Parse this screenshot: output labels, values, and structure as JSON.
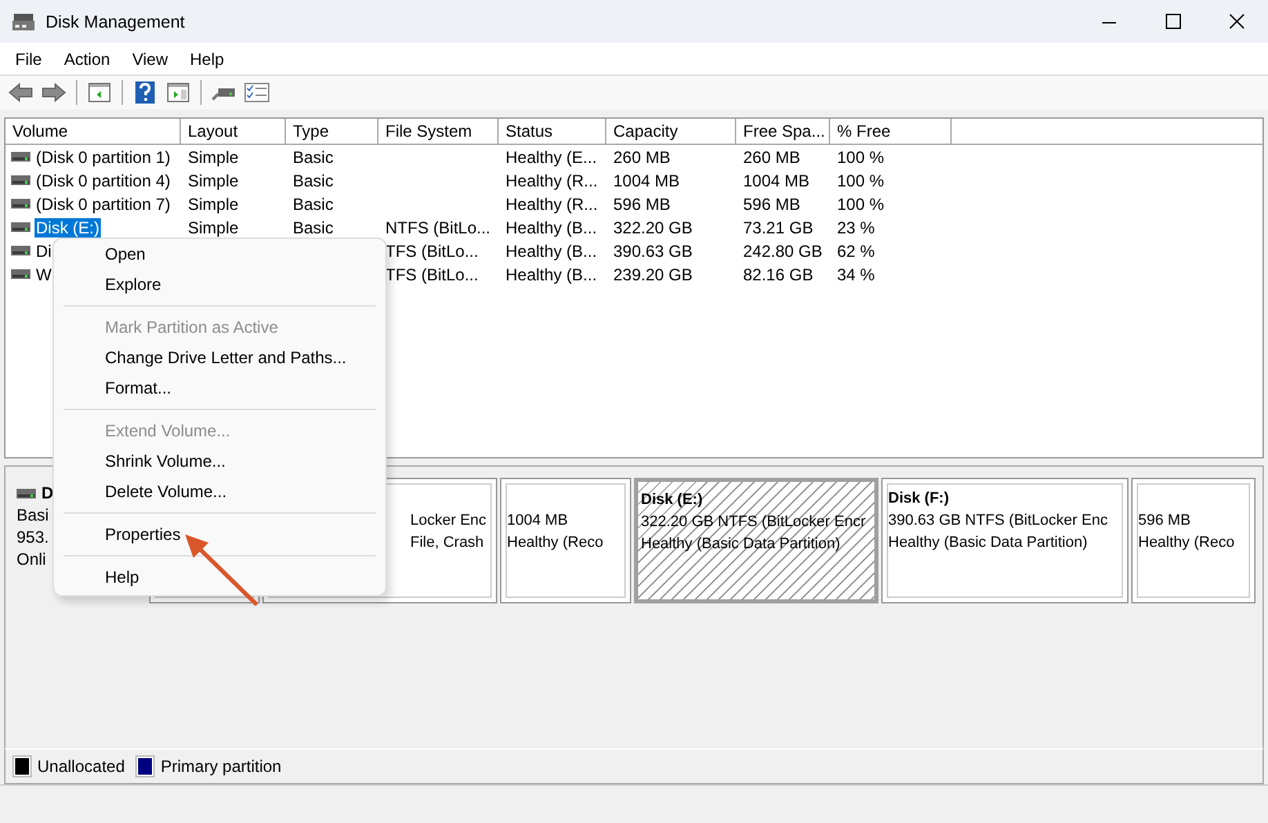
{
  "window": {
    "title": "Disk Management"
  },
  "menu_bar": [
    "File",
    "Action",
    "View",
    "Help"
  ],
  "volume_table": {
    "columns": [
      "Volume",
      "Layout",
      "Type",
      "File System",
      "Status",
      "Capacity",
      "Free Spa...",
      "% Free"
    ],
    "rows": [
      {
        "volume": "(Disk 0 partition 1)",
        "layout": "Simple",
        "type": "Basic",
        "status": "Healthy (E...",
        "capacity": "260 MB",
        "free_space": "260 MB",
        "percent_free": "100 %",
        "selected": false
      },
      {
        "volume": "(Disk 0 partition 4)",
        "layout": "Simple",
        "type": "Basic",
        "status": "Healthy (R...",
        "capacity": "1004 MB",
        "free_space": "1004 MB",
        "percent_free": "100 %",
        "selected": false
      },
      {
        "volume": "(Disk 0 partition 7)",
        "layout": "Simple",
        "type": "Basic",
        "status": "Healthy (R...",
        "capacity": "596 MB",
        "free_space": "596 MB",
        "percent_free": "100 %",
        "selected": false
      },
      {
        "volume": "Disk (E:)",
        "layout": "Simple",
        "type": "Basic",
        "file_system": "NTFS (BitLo...",
        "status": "Healthy (B...",
        "capacity": "322.20 GB",
        "free_space": "73.21 GB",
        "percent_free": "23 %",
        "selected": true
      },
      {
        "volume": "Di",
        "file_system": "TFS (BitLo...",
        "status": "Healthy (B...",
        "capacity": "390.63 GB",
        "free_space": "242.80 GB",
        "percent_free": "62 %",
        "selected": false
      },
      {
        "volume": "W",
        "file_system": "TFS (BitLo...",
        "status": "Healthy (B...",
        "capacity": "239.20 GB",
        "free_space": "82.16 GB",
        "percent_free": "34 %",
        "selected": false
      }
    ]
  },
  "disk_pane": {
    "disk": {
      "name": "D",
      "lines": [
        "Basi",
        "953.",
        "Onli"
      ]
    },
    "partitions": [
      {
        "selected": false
      },
      {
        "lines": [
          "Locker Enc",
          "File, Crash"
        ],
        "selected": false
      },
      {
        "lines": [
          "1004 MB",
          "Healthy (Reco"
        ],
        "selected": false
      },
      {
        "title": "Disk  (E:)",
        "lines": [
          "322.20 GB NTFS (BitLocker Encr",
          "Healthy (Basic Data Partition)"
        ],
        "selected": true
      },
      {
        "title": "Disk  (F:)",
        "lines": [
          "390.63 GB NTFS (BitLocker Enc",
          "Healthy (Basic Data Partition)"
        ],
        "selected": false
      },
      {
        "lines": [
          "596 MB",
          "Healthy (Reco"
        ],
        "selected": false
      }
    ]
  },
  "legend": [
    {
      "label": "Unallocated",
      "color": "#000000"
    },
    {
      "label": "Primary partition",
      "color": "#000080"
    }
  ],
  "context_menu": {
    "items": [
      {
        "kind": "item",
        "label": "Open",
        "disabled": false
      },
      {
        "kind": "item",
        "label": "Explore",
        "disabled": false
      },
      {
        "kind": "separator"
      },
      {
        "kind": "item",
        "label": "Mark Partition as Active",
        "disabled": true
      },
      {
        "kind": "item",
        "label": "Change Drive Letter and Paths...",
        "disabled": false
      },
      {
        "kind": "item",
        "label": "Format...",
        "disabled": false
      },
      {
        "kind": "separator"
      },
      {
        "kind": "item",
        "label": "Extend Volume...",
        "disabled": true
      },
      {
        "kind": "item",
        "label": "Shrink Volume...",
        "disabled": false
      },
      {
        "kind": "item",
        "label": "Delete Volume...",
        "disabled": false
      },
      {
        "kind": "separator"
      },
      {
        "kind": "item",
        "label": "Properties",
        "disabled": false
      },
      {
        "kind": "separator"
      },
      {
        "kind": "item",
        "label": "Help",
        "disabled": false
      }
    ]
  }
}
